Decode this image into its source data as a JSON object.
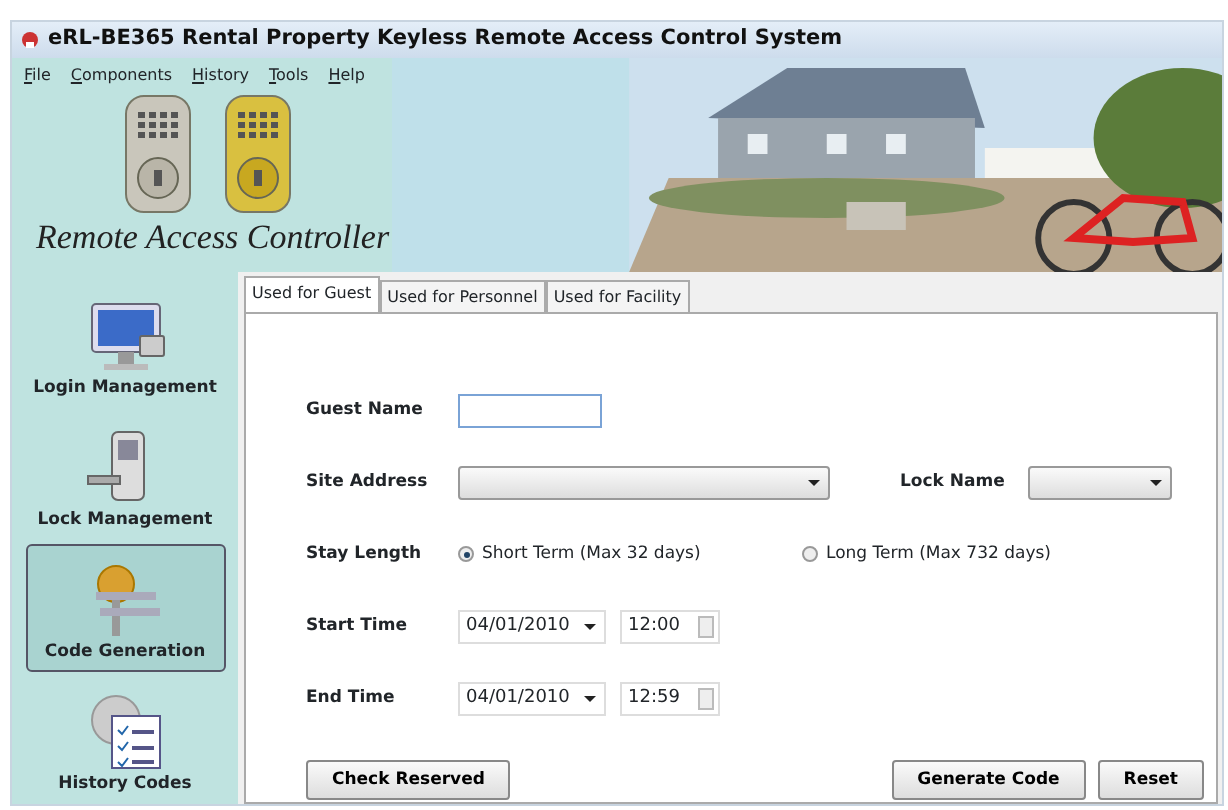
{
  "window": {
    "title": "eRL-BE365 Rental Property Keyless Remote Access Control System"
  },
  "menu": [
    {
      "label": "File"
    },
    {
      "label": "Components"
    },
    {
      "label": "History"
    },
    {
      "label": "Tools"
    },
    {
      "label": "Help"
    }
  ],
  "logo_text": "Remote Access Controller",
  "sidebar": [
    {
      "label": "Login Management",
      "kind": "monitor",
      "selected": false
    },
    {
      "label": "Lock Management",
      "kind": "lock",
      "selected": false
    },
    {
      "label": "Code Generation",
      "kind": "key",
      "selected": true
    },
    {
      "label": "History Codes",
      "kind": "history",
      "selected": false
    }
  ],
  "tabs": [
    {
      "label": "Used for Guest",
      "selected": true
    },
    {
      "label": "Used for Personnel",
      "selected": false
    },
    {
      "label": "Used for Facility",
      "selected": false
    }
  ],
  "form": {
    "guest_name": {
      "label": "Guest Name"
    },
    "site_address": {
      "label": "Site Address"
    },
    "lock_name": {
      "label": "Lock Name"
    },
    "stay_length": {
      "label": "Stay Length",
      "options": [
        {
          "label": "Short Term (Max 32 days)",
          "selected": true
        },
        {
          "label": "Long Term (Max 732 days)",
          "selected": false
        }
      ]
    },
    "start_time": {
      "label": "Start Time",
      "date": "04/01/2010",
      "time": "12:00"
    },
    "end_time": {
      "label": "End Time",
      "date": "04/01/2010",
      "time": "12:59"
    }
  },
  "buttons": [
    {
      "label": "Check Reserved",
      "kind": "left"
    },
    {
      "label": "Generate Code",
      "kind": "right"
    },
    {
      "label": "Reset",
      "kind": "right"
    }
  ]
}
